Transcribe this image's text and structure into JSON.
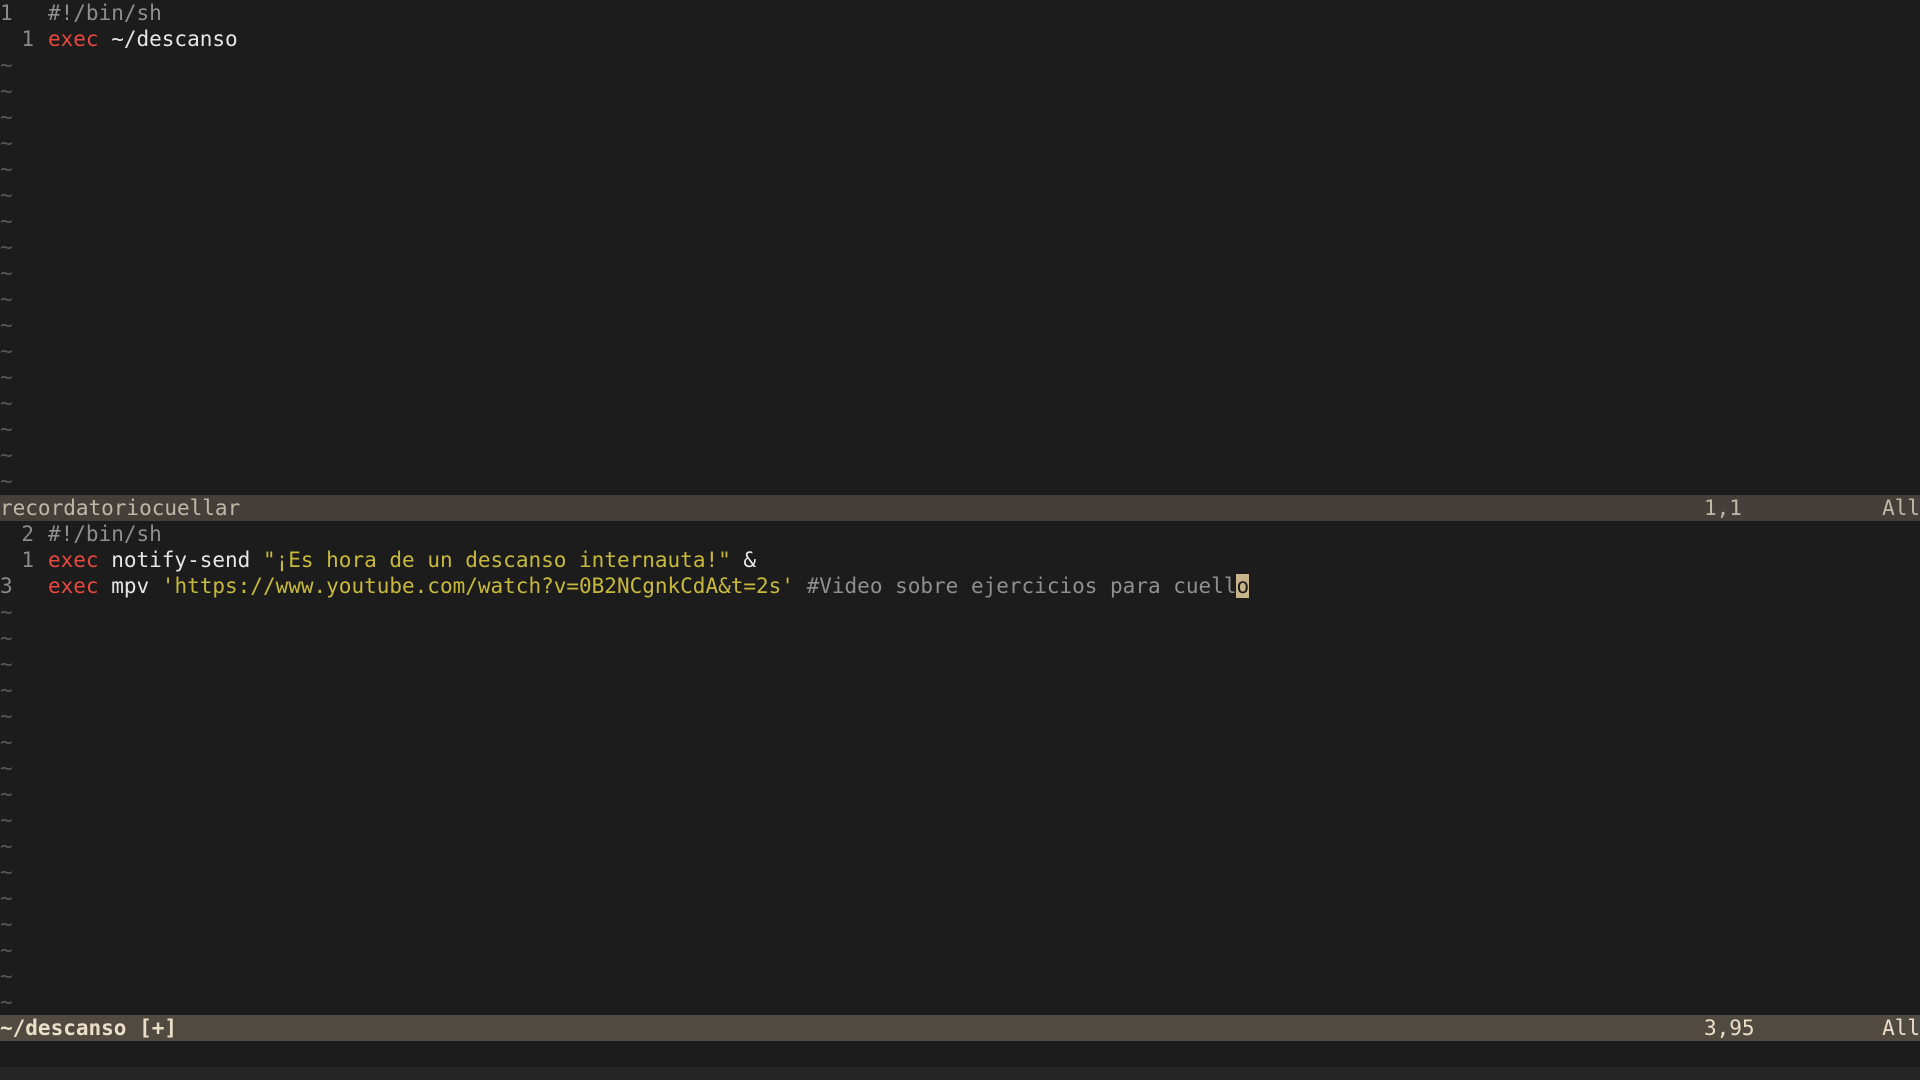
{
  "window": {
    "top_pane": {
      "lines": [
        {
          "number": "1",
          "number_style": "abs",
          "segments": [
            {
              "cls": "cmt",
              "text": "#!/bin/sh"
            }
          ]
        },
        {
          "number": "1",
          "number_style": "rel",
          "segments": [
            {
              "cls": "kw",
              "text": "exec"
            },
            {
              "cls": "plain",
              "text": " ~/descanso"
            }
          ]
        }
      ],
      "tilde_count": 17,
      "tilde_char": "~",
      "status": {
        "filename": "recordatoriocuellar",
        "position": "1,1",
        "scroll": "All"
      }
    },
    "bottom_pane": {
      "lines": [
        {
          "number": "2",
          "number_style": "rel",
          "segments": [
            {
              "cls": "cmt",
              "text": "#!/bin/sh"
            }
          ]
        },
        {
          "number": "1",
          "number_style": "rel",
          "segments": [
            {
              "cls": "kw",
              "text": "exec"
            },
            {
              "cls": "plain",
              "text": " notify-send "
            },
            {
              "cls": "str",
              "text": "\"¡Es hora de un descanso internauta!\""
            },
            {
              "cls": "plain",
              "text": " &"
            }
          ]
        },
        {
          "number": "3",
          "number_style": "abs",
          "segments": [
            {
              "cls": "kw",
              "text": "exec"
            },
            {
              "cls": "plain",
              "text": " mpv "
            },
            {
              "cls": "str",
              "text": "'https://www.youtube.com/watch?v=0B2NCgnkCdA&t=2s'"
            },
            {
              "cls": "plain",
              "text": " "
            },
            {
              "cls": "cmt",
              "text": "#Video sobre ejercicios para cuell"
            },
            {
              "cls": "cursor",
              "text": "o"
            }
          ]
        }
      ],
      "tilde_count": 16,
      "tilde_char": "~",
      "status": {
        "filename": "~/descanso [+]",
        "position": "3,95",
        "scroll": "All"
      }
    }
  },
  "colors": {
    "background": "#1c1c1c",
    "keyword": "#e8483f",
    "string": "#c8b93c",
    "comment": "#8f8f8f",
    "statusline_inactive": "#444039",
    "statusline_active": "#504a40",
    "cursor": "#c9b48a"
  }
}
